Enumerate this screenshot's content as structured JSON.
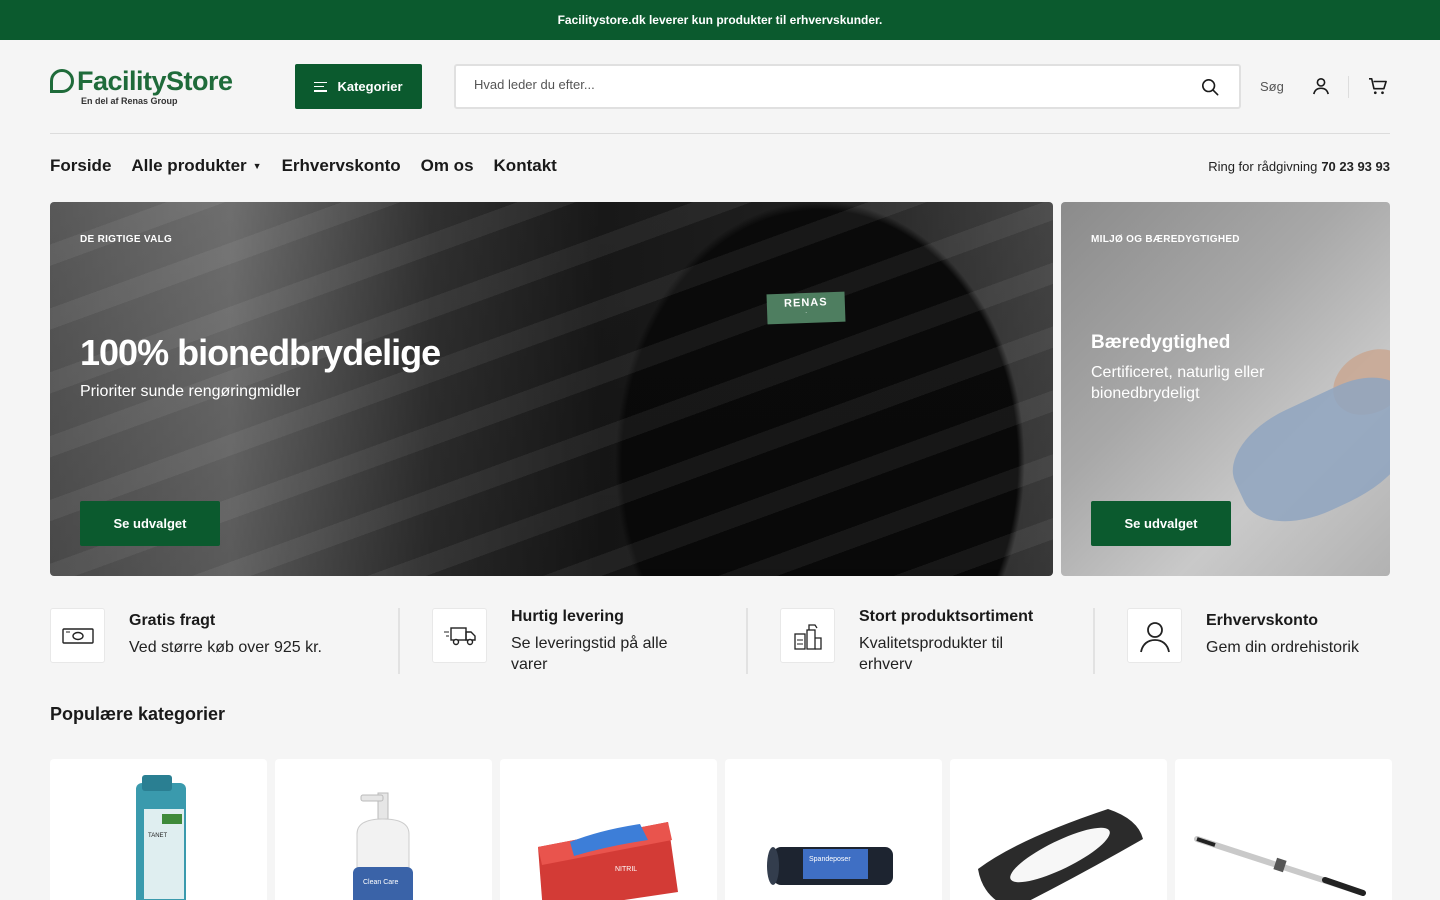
{
  "topbar": {
    "text": "Facilitystore.dk leverer kun produkter til erhvervskunder."
  },
  "logo": {
    "name": "FacilityStore",
    "tagline": "En del af Renas Group"
  },
  "header": {
    "categories_button": "Kategorier",
    "search_placeholder": "Hvad leder du efter...",
    "search_label": "Søg"
  },
  "nav": {
    "items": [
      {
        "label": "Forside"
      },
      {
        "label": "Alle produkter",
        "has_dropdown": true
      },
      {
        "label": "Erhvervskonto"
      },
      {
        "label": "Om os"
      },
      {
        "label": "Kontakt"
      }
    ],
    "phone_label": "Ring for rådgivning",
    "phone_number": "70 23 93 93"
  },
  "hero": {
    "eyebrow": "DE RIGTIGE VALG",
    "title": "100% bionedbrydelige",
    "subtitle": "Prioriter sunde rengøringmidler",
    "badge": "RENAS",
    "cta": "Se udvalget"
  },
  "side_banner": {
    "eyebrow": "MILJØ OG BÆREDYGTIGHED",
    "title": "Bæredygtighed",
    "subtitle": "Certificeret, naturlig eller bionedbrydeligt",
    "cta": "Se udvalget"
  },
  "features": [
    {
      "icon": "money-bill-icon",
      "title": "Gratis fragt",
      "text": "Ved større køb over 925 kr."
    },
    {
      "icon": "delivery-truck-icon",
      "title": "Hurtig levering",
      "text": "Se leveringstid på alle varer"
    },
    {
      "icon": "cleaning-products-icon",
      "title": "Stort produktsortiment",
      "text": "Kvalitetsprodukter til erhverv"
    },
    {
      "icon": "user-icon",
      "title": "Erhvervskonto",
      "text": "Gem din ordrehistorik"
    }
  ],
  "popular": {
    "title": "Populære kategorier",
    "items": [
      {
        "product": "cleaning-bottle",
        "label": "TANET"
      },
      {
        "product": "soap-pump",
        "label": "Clean Care"
      },
      {
        "product": "glove-box",
        "label": "NITRIL"
      },
      {
        "product": "bag-roll",
        "label": "Spandeposer"
      },
      {
        "product": "floor-pad"
      },
      {
        "product": "telescopic-pole"
      }
    ]
  },
  "colors": {
    "brand_green": "#0b5a2e",
    "logo_green": "#1f6b3a"
  }
}
